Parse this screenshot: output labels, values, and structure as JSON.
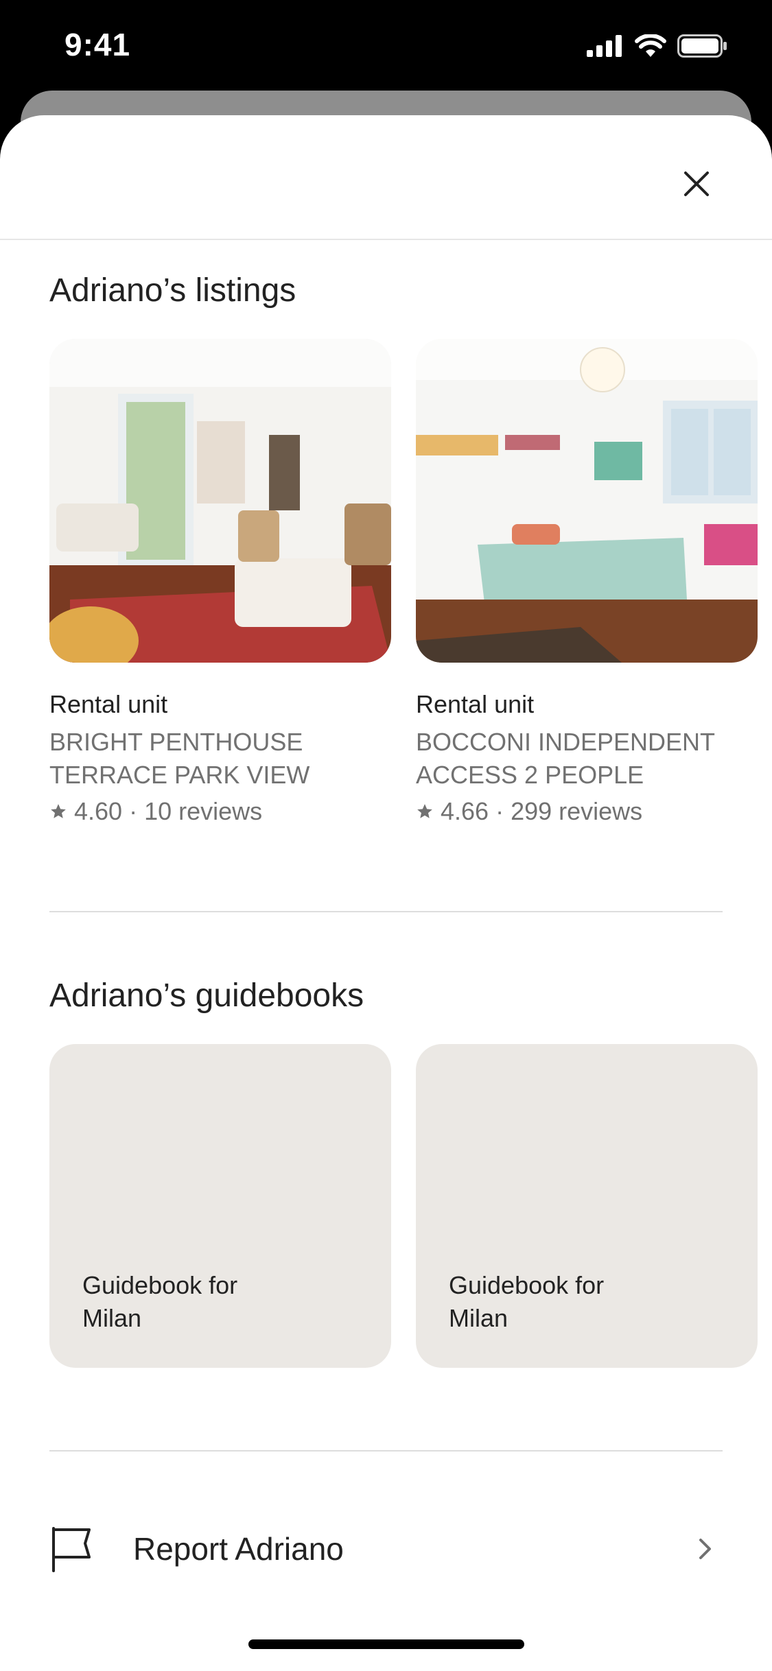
{
  "status_bar": {
    "time": "9:41"
  },
  "listings": {
    "title": "Adriano’s listings",
    "items": [
      {
        "type": "Rental unit",
        "name": "BRIGHT PENTHOUSE TERRACE PARK VIEW",
        "rating": "4.60",
        "reviews": "10 reviews"
      },
      {
        "type": "Rental unit",
        "name": "BOCCONI INDEPENDENT ACCESS 2 PEOPLE",
        "rating": "4.66",
        "reviews": "299 reviews"
      }
    ]
  },
  "guidebooks": {
    "title": "Adriano’s guidebooks",
    "items": [
      {
        "label": "Guidebook for Milan"
      },
      {
        "label": "Guidebook for Milan"
      }
    ]
  },
  "report": {
    "label": "Report Adriano"
  },
  "icons": {
    "close": "close-icon",
    "star": "star-icon",
    "flag": "flag-icon",
    "chevron": "chevron-right-icon",
    "signal": "signal-icon",
    "wifi": "wifi-icon",
    "battery": "battery-icon"
  },
  "colors": {
    "card_bg": "#ebe8e4",
    "muted_text": "#717171",
    "text": "#222222"
  }
}
